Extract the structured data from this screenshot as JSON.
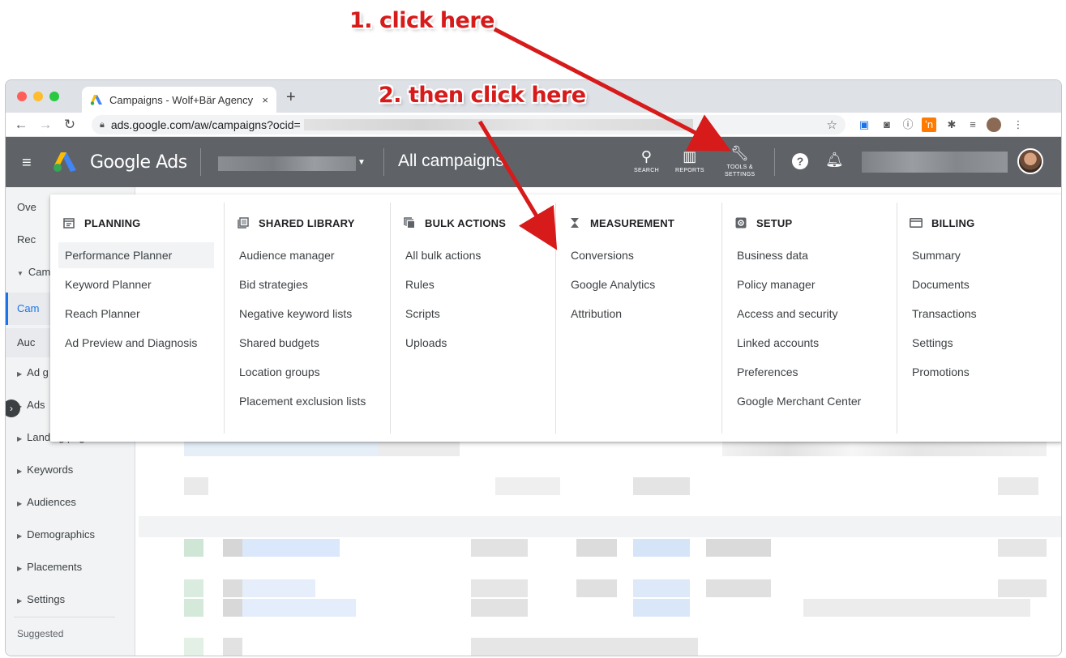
{
  "annotations": {
    "step1": "1. click here",
    "step2": "2. then click here"
  },
  "browser": {
    "tab_title": "Campaigns - Wolf+Bär Agency",
    "tab_close": "×",
    "new_tab": "+",
    "url": "ads.google.com/aw/campaigns?ocid="
  },
  "header": {
    "brand": "Google Ads",
    "page_title": "All campaigns",
    "search_label": "SEARCH",
    "reports_label": "REPORTS",
    "tools_label_line1": "TOOLS &",
    "tools_label_line2": "SETTINGS"
  },
  "sidebar": {
    "items": [
      {
        "label": "Ove"
      },
      {
        "label": "Rec"
      },
      {
        "label": "Cam"
      },
      {
        "label": "Cam"
      },
      {
        "label": "Auc"
      },
      {
        "label": "Ad g"
      },
      {
        "label": "Ads"
      },
      {
        "label": "Landing pages"
      },
      {
        "label": "Keywords"
      },
      {
        "label": "Audiences"
      },
      {
        "label": "Demographics"
      },
      {
        "label": "Placements"
      },
      {
        "label": "Settings"
      },
      {
        "label": "Suggested"
      }
    ]
  },
  "menu": {
    "columns": [
      {
        "heading": "PLANNING",
        "icon": "calendar-icon",
        "items": [
          "Performance Planner",
          "Keyword Planner",
          "Reach Planner",
          "Ad Preview and Diagnosis"
        ]
      },
      {
        "heading": "SHARED LIBRARY",
        "icon": "library-icon",
        "items": [
          "Audience manager",
          "Bid strategies",
          "Negative keyword lists",
          "Shared budgets",
          "Location groups",
          "Placement exclusion lists"
        ]
      },
      {
        "heading": "BULK ACTIONS",
        "icon": "copy-icon",
        "items": [
          "All bulk actions",
          "Rules",
          "Scripts",
          "Uploads"
        ]
      },
      {
        "heading": "MEASUREMENT",
        "icon": "hourglass-icon",
        "items": [
          "Conversions",
          "Google Analytics",
          "Attribution"
        ]
      },
      {
        "heading": "SETUP",
        "icon": "gear-box-icon",
        "items": [
          "Business data",
          "Policy manager",
          "Access and security",
          "Linked accounts",
          "Preferences",
          "Google Merchant Center"
        ]
      },
      {
        "heading": "BILLING",
        "icon": "card-icon",
        "items": [
          "Summary",
          "Documents",
          "Transactions",
          "Settings",
          "Promotions"
        ]
      }
    ]
  },
  "colors": {
    "annotation_red": "#d71a1a",
    "header_gray": "#5f6368",
    "accent_blue": "#1a73e8"
  }
}
